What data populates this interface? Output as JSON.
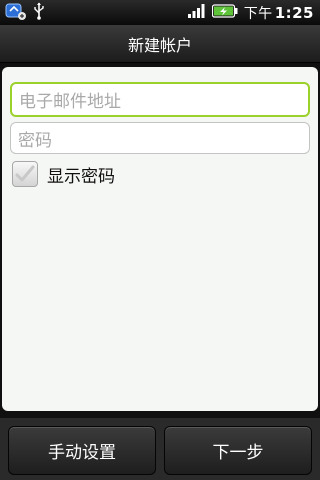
{
  "status_bar": {
    "ampm": "下午",
    "time": "1:25",
    "icons": [
      "sync-app-icon",
      "usb-icon",
      "signal-icon",
      "battery-charging-icon"
    ]
  },
  "header": {
    "title": "新建帐户"
  },
  "form": {
    "email_placeholder": "电子邮件地址",
    "password_placeholder": "密码",
    "show_password_label": "显示密码",
    "show_password_checked": false
  },
  "buttons": {
    "manual_setup": "手动设置",
    "next": "下一步"
  },
  "colors": {
    "accent_focus": "#9bd12b",
    "content_bg": "#f5f7f4",
    "bar_bg": "#1c1c1c"
  }
}
